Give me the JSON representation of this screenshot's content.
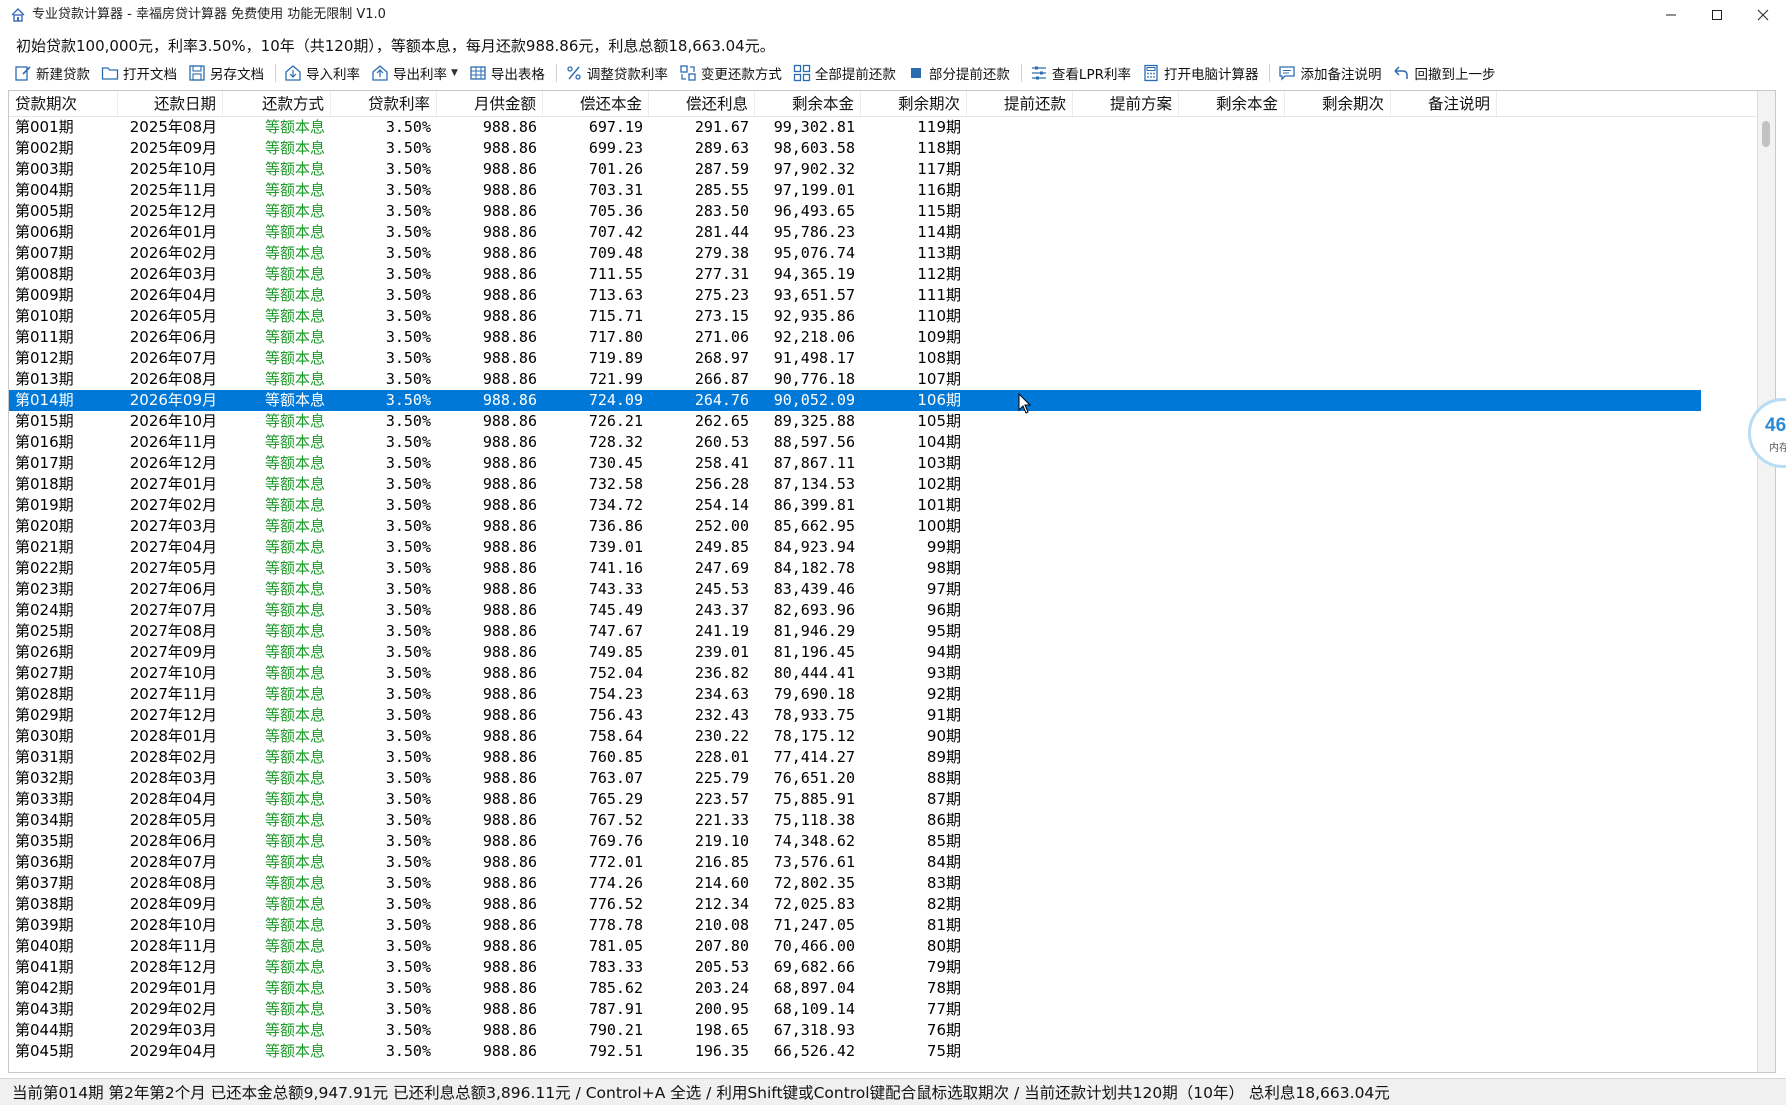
{
  "window": {
    "title": "专业贷款计算器 - 幸福房贷计算器 免费使用 功能无限制 V1.0",
    "icons": {
      "app": "house-icon",
      "minimize": "minimize-icon",
      "maximize": "maximize-icon",
      "close": "close-icon"
    }
  },
  "info": {
    "summary": "初始贷款100,000元，利率3.50%，10年（共120期），等额本息，每月还款988.86元，利息总额18,663.04元。"
  },
  "toolbar": {
    "new_loan": "新建贷款",
    "open_doc": "打开文档",
    "save_as": "另存文档",
    "import_rate": "导入利率",
    "export_rate": "导出利率",
    "export_table": "导出表格",
    "adjust_rate": "调整贷款利率",
    "change_method": "变更还款方式",
    "full_prepay": "全部提前还款",
    "partial_prepay": "部分提前还款",
    "view_lpr": "查看LPR利率",
    "open_calculator": "打开电脑计算器",
    "add_note": "添加备注说明",
    "undo": "回撤到上一步"
  },
  "table": {
    "headers": [
      "贷款期次",
      "还款日期",
      "还款方式",
      "贷款利率",
      "月供金额",
      "偿还本金",
      "偿还利息",
      "剩余本金",
      "剩余期次",
      "提前还款",
      "提前方案",
      "剩余本金",
      "剩余期次",
      "备注说明"
    ],
    "selected_row": 13,
    "rows": [
      [
        "第001期",
        "2025年08月",
        "等额本息",
        "3.50%",
        "988.86",
        "697.19",
        "291.67",
        "99,302.81",
        "119期"
      ],
      [
        "第002期",
        "2025年09月",
        "等额本息",
        "3.50%",
        "988.86",
        "699.23",
        "289.63",
        "98,603.58",
        "118期"
      ],
      [
        "第003期",
        "2025年10月",
        "等额本息",
        "3.50%",
        "988.86",
        "701.26",
        "287.59",
        "97,902.32",
        "117期"
      ],
      [
        "第004期",
        "2025年11月",
        "等额本息",
        "3.50%",
        "988.86",
        "703.31",
        "285.55",
        "97,199.01",
        "116期"
      ],
      [
        "第005期",
        "2025年12月",
        "等额本息",
        "3.50%",
        "988.86",
        "705.36",
        "283.50",
        "96,493.65",
        "115期"
      ],
      [
        "第006期",
        "2026年01月",
        "等额本息",
        "3.50%",
        "988.86",
        "707.42",
        "281.44",
        "95,786.23",
        "114期"
      ],
      [
        "第007期",
        "2026年02月",
        "等额本息",
        "3.50%",
        "988.86",
        "709.48",
        "279.38",
        "95,076.74",
        "113期"
      ],
      [
        "第008期",
        "2026年03月",
        "等额本息",
        "3.50%",
        "988.86",
        "711.55",
        "277.31",
        "94,365.19",
        "112期"
      ],
      [
        "第009期",
        "2026年04月",
        "等额本息",
        "3.50%",
        "988.86",
        "713.63",
        "275.23",
        "93,651.57",
        "111期"
      ],
      [
        "第010期",
        "2026年05月",
        "等额本息",
        "3.50%",
        "988.86",
        "715.71",
        "273.15",
        "92,935.86",
        "110期"
      ],
      [
        "第011期",
        "2026年06月",
        "等额本息",
        "3.50%",
        "988.86",
        "717.80",
        "271.06",
        "92,218.06",
        "109期"
      ],
      [
        "第012期",
        "2026年07月",
        "等额本息",
        "3.50%",
        "988.86",
        "719.89",
        "268.97",
        "91,498.17",
        "108期"
      ],
      [
        "第013期",
        "2026年08月",
        "等额本息",
        "3.50%",
        "988.86",
        "721.99",
        "266.87",
        "90,776.18",
        "107期"
      ],
      [
        "第014期",
        "2026年09月",
        "等额本息",
        "3.50%",
        "988.86",
        "724.09",
        "264.76",
        "90,052.09",
        "106期"
      ],
      [
        "第015期",
        "2026年10月",
        "等额本息",
        "3.50%",
        "988.86",
        "726.21",
        "262.65",
        "89,325.88",
        "105期"
      ],
      [
        "第016期",
        "2026年11月",
        "等额本息",
        "3.50%",
        "988.86",
        "728.32",
        "260.53",
        "88,597.56",
        "104期"
      ],
      [
        "第017期",
        "2026年12月",
        "等额本息",
        "3.50%",
        "988.86",
        "730.45",
        "258.41",
        "87,867.11",
        "103期"
      ],
      [
        "第018期",
        "2027年01月",
        "等额本息",
        "3.50%",
        "988.86",
        "732.58",
        "256.28",
        "87,134.53",
        "102期"
      ],
      [
        "第019期",
        "2027年02月",
        "等额本息",
        "3.50%",
        "988.86",
        "734.72",
        "254.14",
        "86,399.81",
        "101期"
      ],
      [
        "第020期",
        "2027年03月",
        "等额本息",
        "3.50%",
        "988.86",
        "736.86",
        "252.00",
        "85,662.95",
        "100期"
      ],
      [
        "第021期",
        "2027年04月",
        "等额本息",
        "3.50%",
        "988.86",
        "739.01",
        "249.85",
        "84,923.94",
        "99期"
      ],
      [
        "第022期",
        "2027年05月",
        "等额本息",
        "3.50%",
        "988.86",
        "741.16",
        "247.69",
        "84,182.78",
        "98期"
      ],
      [
        "第023期",
        "2027年06月",
        "等额本息",
        "3.50%",
        "988.86",
        "743.33",
        "245.53",
        "83,439.46",
        "97期"
      ],
      [
        "第024期",
        "2027年07月",
        "等额本息",
        "3.50%",
        "988.86",
        "745.49",
        "243.37",
        "82,693.96",
        "96期"
      ],
      [
        "第025期",
        "2027年08月",
        "等额本息",
        "3.50%",
        "988.86",
        "747.67",
        "241.19",
        "81,946.29",
        "95期"
      ],
      [
        "第026期",
        "2027年09月",
        "等额本息",
        "3.50%",
        "988.86",
        "749.85",
        "239.01",
        "81,196.45",
        "94期"
      ],
      [
        "第027期",
        "2027年10月",
        "等额本息",
        "3.50%",
        "988.86",
        "752.04",
        "236.82",
        "80,444.41",
        "93期"
      ],
      [
        "第028期",
        "2027年11月",
        "等额本息",
        "3.50%",
        "988.86",
        "754.23",
        "234.63",
        "79,690.18",
        "92期"
      ],
      [
        "第029期",
        "2027年12月",
        "等额本息",
        "3.50%",
        "988.86",
        "756.43",
        "232.43",
        "78,933.75",
        "91期"
      ],
      [
        "第030期",
        "2028年01月",
        "等额本息",
        "3.50%",
        "988.86",
        "758.64",
        "230.22",
        "78,175.12",
        "90期"
      ],
      [
        "第031期",
        "2028年02月",
        "等额本息",
        "3.50%",
        "988.86",
        "760.85",
        "228.01",
        "77,414.27",
        "89期"
      ],
      [
        "第032期",
        "2028年03月",
        "等额本息",
        "3.50%",
        "988.86",
        "763.07",
        "225.79",
        "76,651.20",
        "88期"
      ],
      [
        "第033期",
        "2028年04月",
        "等额本息",
        "3.50%",
        "988.86",
        "765.29",
        "223.57",
        "75,885.91",
        "87期"
      ],
      [
        "第034期",
        "2028年05月",
        "等额本息",
        "3.50%",
        "988.86",
        "767.52",
        "221.33",
        "75,118.38",
        "86期"
      ],
      [
        "第035期",
        "2028年06月",
        "等额本息",
        "3.50%",
        "988.86",
        "769.76",
        "219.10",
        "74,348.62",
        "85期"
      ],
      [
        "第036期",
        "2028年07月",
        "等额本息",
        "3.50%",
        "988.86",
        "772.01",
        "216.85",
        "73,576.61",
        "84期"
      ],
      [
        "第037期",
        "2028年08月",
        "等额本息",
        "3.50%",
        "988.86",
        "774.26",
        "214.60",
        "72,802.35",
        "83期"
      ],
      [
        "第038期",
        "2028年09月",
        "等额本息",
        "3.50%",
        "988.86",
        "776.52",
        "212.34",
        "72,025.83",
        "82期"
      ],
      [
        "第039期",
        "2028年10月",
        "等额本息",
        "3.50%",
        "988.86",
        "778.78",
        "210.08",
        "71,247.05",
        "81期"
      ],
      [
        "第040期",
        "2028年11月",
        "等额本息",
        "3.50%",
        "988.86",
        "781.05",
        "207.80",
        "70,466.00",
        "80期"
      ],
      [
        "第041期",
        "2028年12月",
        "等额本息",
        "3.50%",
        "988.86",
        "783.33",
        "205.53",
        "69,682.66",
        "79期"
      ],
      [
        "第042期",
        "2029年01月",
        "等额本息",
        "3.50%",
        "988.86",
        "785.62",
        "203.24",
        "68,897.04",
        "78期"
      ],
      [
        "第043期",
        "2029年02月",
        "等额本息",
        "3.50%",
        "988.86",
        "787.91",
        "200.95",
        "68,109.14",
        "77期"
      ],
      [
        "第044期",
        "2029年03月",
        "等额本息",
        "3.50%",
        "988.86",
        "790.21",
        "198.65",
        "67,318.93",
        "76期"
      ],
      [
        "第045期",
        "2029年04月",
        "等额本息",
        "3.50%",
        "988.86",
        "792.51",
        "196.35",
        "66,526.42",
        "75期"
      ]
    ]
  },
  "widget": {
    "number": "46",
    "label": "内存"
  },
  "status": {
    "text": "当前第014期  第2年第2个月  已还本金总额9,947.91元  已还利息总额3,896.11元  /  Control+A 全选  /  利用Shift键或Control键配合鼠标选取期次  /  当前还款计划共120期（10年）  总利息18,663.04元"
  },
  "colors": {
    "selection": "#0078d7",
    "method_text": "#1e9a2a",
    "icon_blue": "#2b6cb0"
  }
}
